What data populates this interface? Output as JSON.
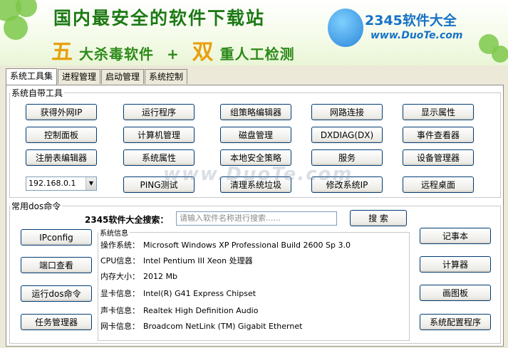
{
  "banner": {
    "title": "国内最安全的软件下载站",
    "sub_big1": "五",
    "sub_text1": "大杀毒软件",
    "sub_plus": "+",
    "sub_big2": "双",
    "sub_text2": "重人工检测",
    "logo_brand": "2345软件大全",
    "logo_url": "www.DuoTe.com"
  },
  "tabs": [
    "系统工具集",
    "进程管理",
    "启动管理",
    "系统控制"
  ],
  "builtin_tools": {
    "legend": "系统自带工具",
    "buttons": [
      "获得外网IP",
      "运行程序",
      "组策略编辑器",
      "网路连接",
      "显示属性",
      "控制面板",
      "计算机管理",
      "磁盘管理",
      "DXDIAG(DX)",
      "事件查看器",
      "注册表编辑器",
      "系统属性",
      "本地安全策略",
      "服务",
      "设备管理器",
      "PING测试",
      "清理系统垃圾",
      "修改系统IP",
      "远程桌面"
    ],
    "ip_value": "192.168.0.1"
  },
  "dos": {
    "legend": "常用dos命令",
    "search_label": "2345软件大全搜索：",
    "search_placeholder": "请输入软件名称进行搜索......",
    "search_button": "搜 索",
    "left_buttons": [
      "IPconfig",
      "端口查看",
      "运行dos命令",
      "任务管理器"
    ],
    "right_buttons": [
      "记事本",
      "计算器",
      "画图板",
      "系统配置程序"
    ]
  },
  "sysinfo": {
    "legend": "系统信息",
    "rows": [
      {
        "k": "操作系统：",
        "v": "Microsoft Windows XP Professional Build 2600 Sp 3.0"
      },
      {
        "k": "CPU信息：",
        "v": "Intel Pentium III Xeon 处理器"
      },
      {
        "k": "内存大小：",
        "v": "2012 Mb"
      },
      {
        "k": "显卡信息：",
        "v": "Intel(R) G41 Express Chipset"
      },
      {
        "k": "声卡信息：",
        "v": "Realtek High Definition Audio"
      },
      {
        "k": "网卡信息：",
        "v": "Broadcom NetLink (TM) Gigabit Ethernet"
      }
    ]
  },
  "watermark": "www.DuoTe.com"
}
